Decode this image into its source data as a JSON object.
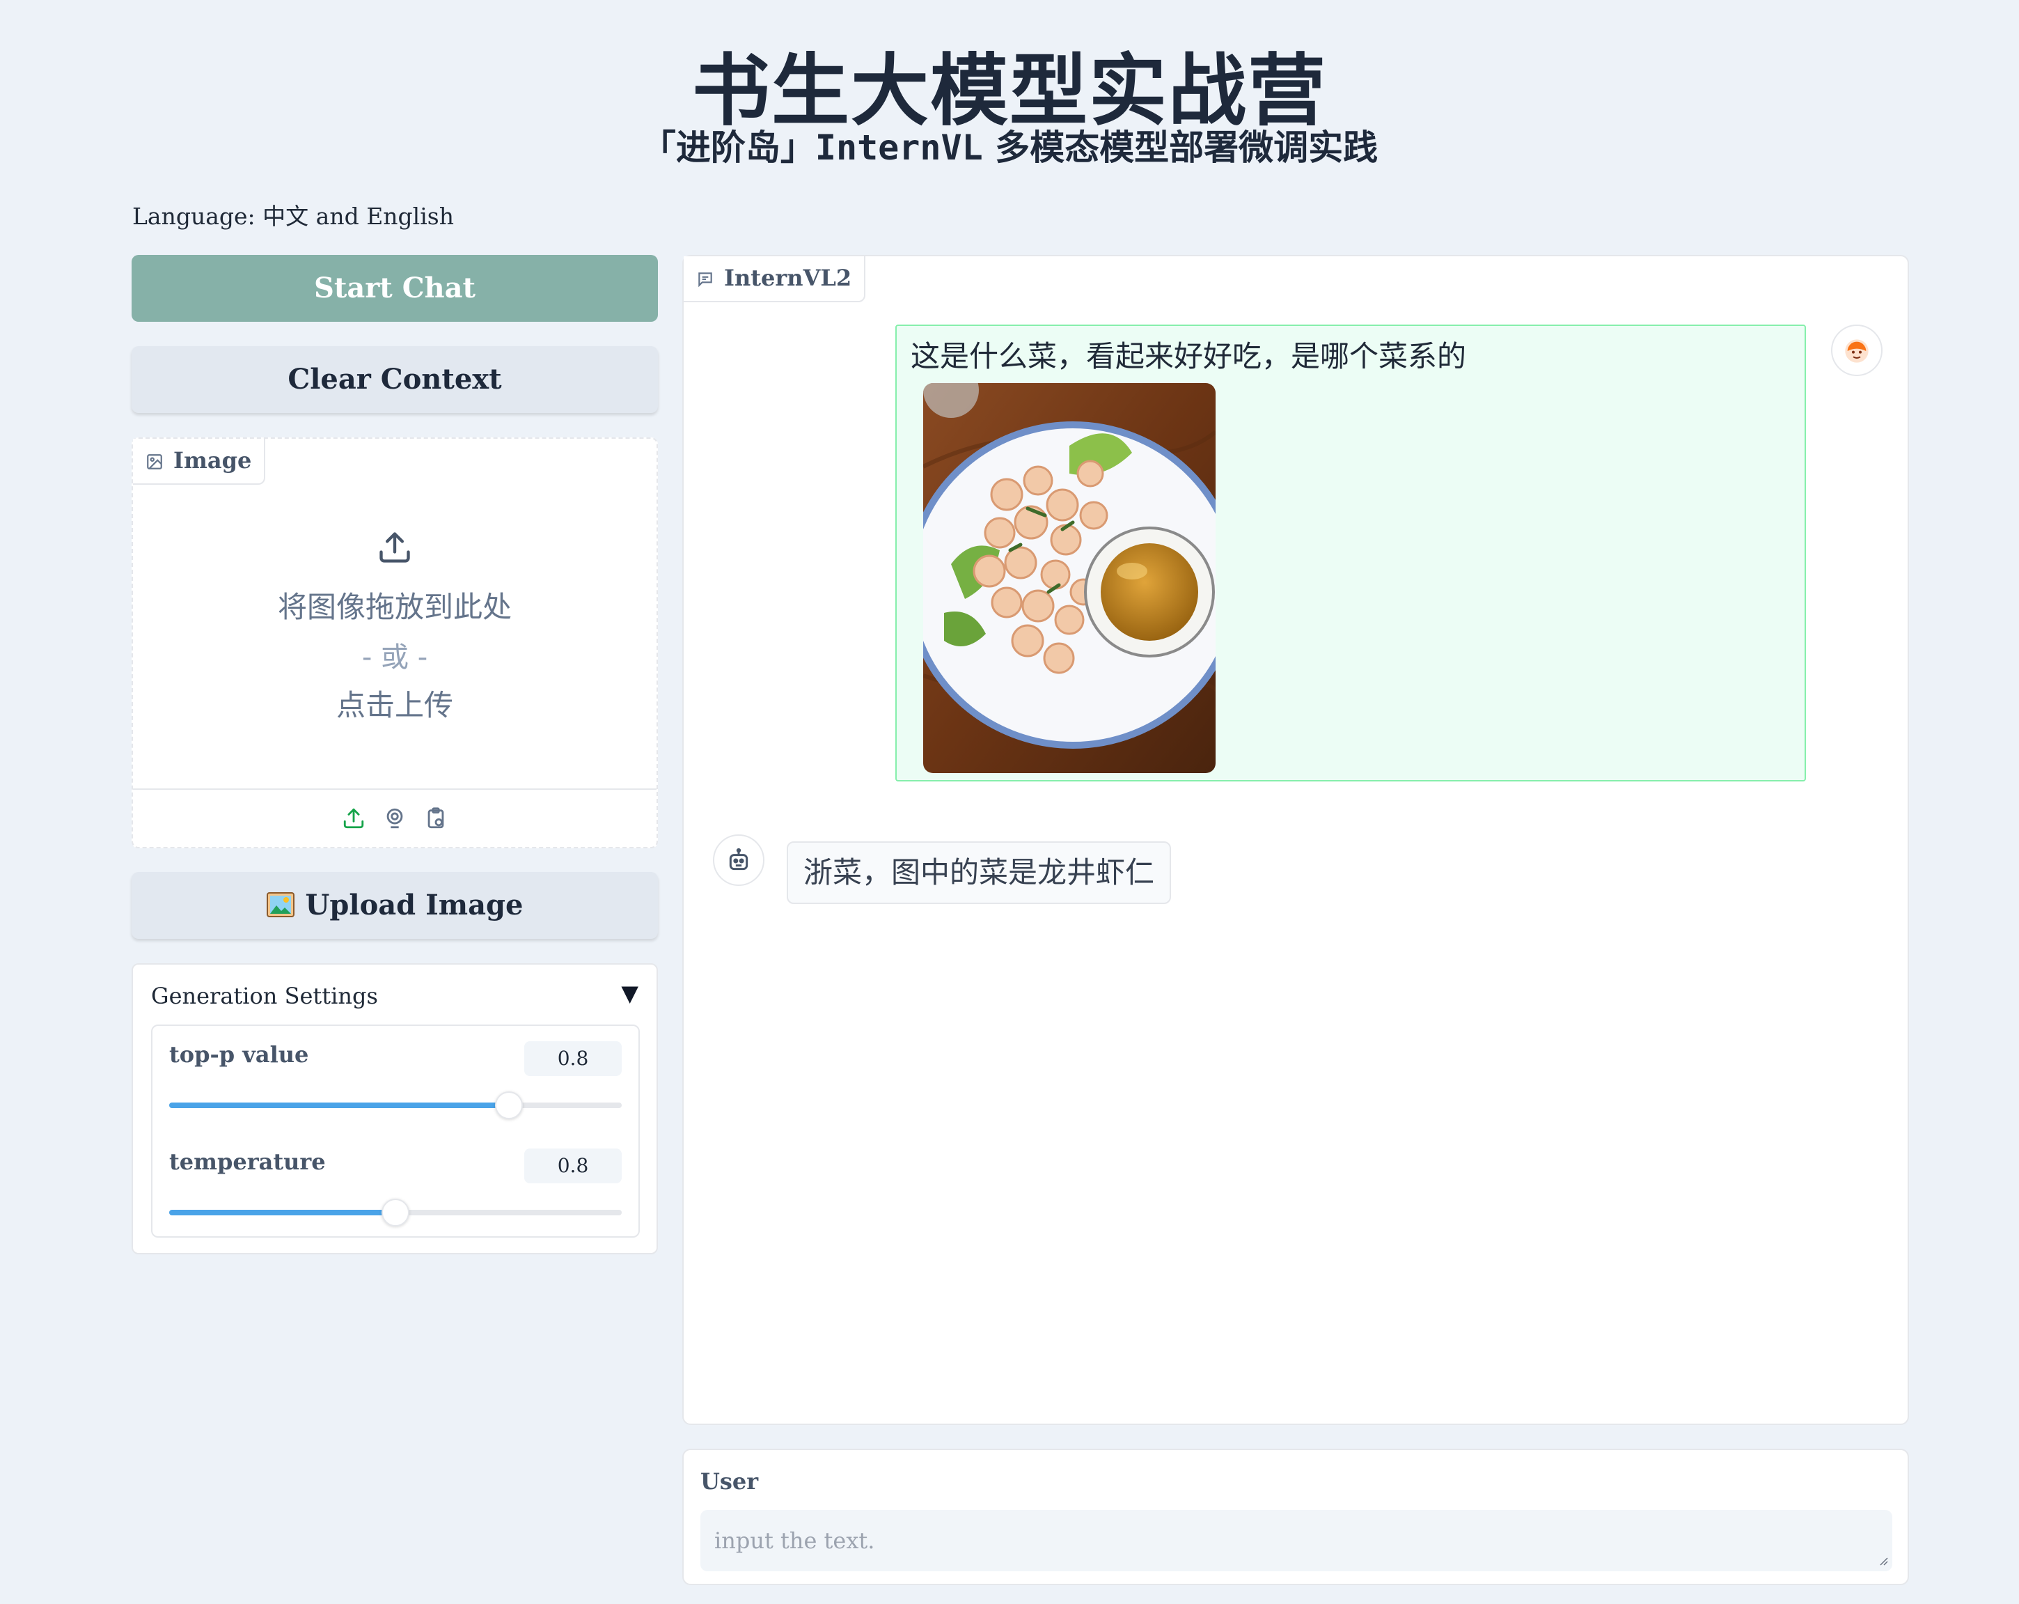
{
  "header": {
    "title": "书生大模型实战营",
    "subtitle_prefix": "「进阶岛」",
    "subtitle_mono": "InternVL",
    "subtitle_suffix": " 多模态模型部署微调实践"
  },
  "language_note": "Language: 中文 and English",
  "buttons": {
    "start_chat": "Start Chat",
    "clear_context": "Clear Context",
    "upload_image": "Upload Image"
  },
  "image_input": {
    "label": "Image",
    "drop_text": "将图像拖放到此处",
    "or_text": "- 或 -",
    "click_text": "点击上传",
    "tool_icons": [
      "upload-icon",
      "webcam-icon",
      "clipboard-icon"
    ]
  },
  "generation_settings": {
    "title": "Generation Settings",
    "toggle_symbol": "▼",
    "sliders": [
      {
        "label": "top-p value",
        "value": "0.8",
        "fraction": 0.75
      },
      {
        "label": "temperature",
        "value": "0.8",
        "fraction": 0.5
      }
    ]
  },
  "chat": {
    "label": "InternVL2",
    "messages": [
      {
        "role": "user",
        "text": "这是什么菜，看起来好好吃，是哪个菜系的",
        "has_image": true
      },
      {
        "role": "bot",
        "text": "浙菜，图中的菜是龙井虾仁"
      }
    ]
  },
  "user_input": {
    "label": "User",
    "placeholder": "input the text.",
    "value": ""
  },
  "colors": {
    "page_bg": "#edf2f8",
    "start_button": "#86b1a8",
    "user_bubble_bg": "#ecfdf5",
    "user_bubble_border": "#86efac",
    "slider_fill": "#4aa3e8",
    "upload_icon_color": "#16a34a",
    "user_avatar_color": "#f97316"
  }
}
